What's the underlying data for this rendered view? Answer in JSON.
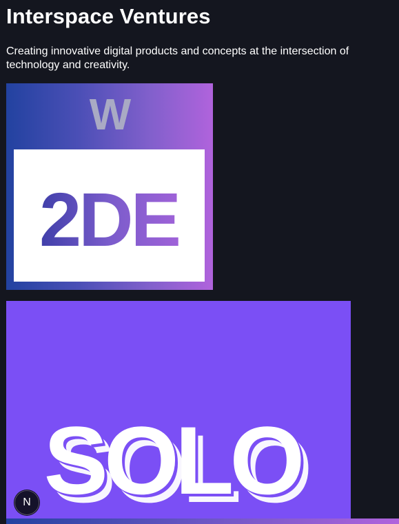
{
  "header": {
    "title": "Interspace Ventures",
    "description": "Creating innovative digital products and concepts at the intersection of technology and creativity."
  },
  "projects": [
    {
      "logo_top_letter": "W",
      "logo_text": "2DE",
      "colors": {
        "gradient_start": "#2242a0",
        "gradient_end": "#b063dc",
        "letter_top": "#a9aac4"
      }
    },
    {
      "logo_text": "SOLO",
      "colors": {
        "background": "#7b4ff5",
        "text": "#ffffff"
      }
    }
  ],
  "dev_badge": {
    "letter": "N",
    "icon": "nextjs-icon"
  },
  "colors": {
    "page_background": "#14161f",
    "text": "#ffffff"
  }
}
